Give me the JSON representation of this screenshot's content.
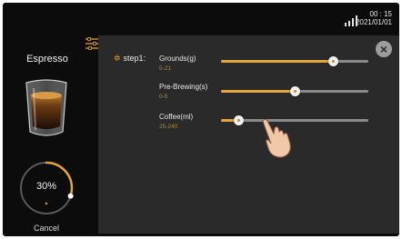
{
  "status": {
    "time": "00 : 15",
    "date": "2021/01/01"
  },
  "left": {
    "title": "Espresso",
    "progress_percent": 30,
    "progress_label": "30%",
    "cancel_label": "Cancel"
  },
  "panel": {
    "step_label": "step1:",
    "settings": [
      {
        "label": "Grounds(g)",
        "range": "5-21",
        "value_fraction": 0.76
      },
      {
        "label": "Pre-Brewing(s)",
        "range": "0-5",
        "value_fraction": 0.5
      },
      {
        "label": "Coffee(ml)",
        "range": "25-240",
        "value_fraction": 0.12
      }
    ]
  },
  "colors": {
    "accent": "#e6a53a",
    "background": "#0c0c0c",
    "panel": "#2a2a2a"
  },
  "icons": [
    "signal-icon",
    "menu-sliders-icon",
    "close-icon",
    "espresso-cup-icon",
    "hand-pointer-icon"
  ]
}
